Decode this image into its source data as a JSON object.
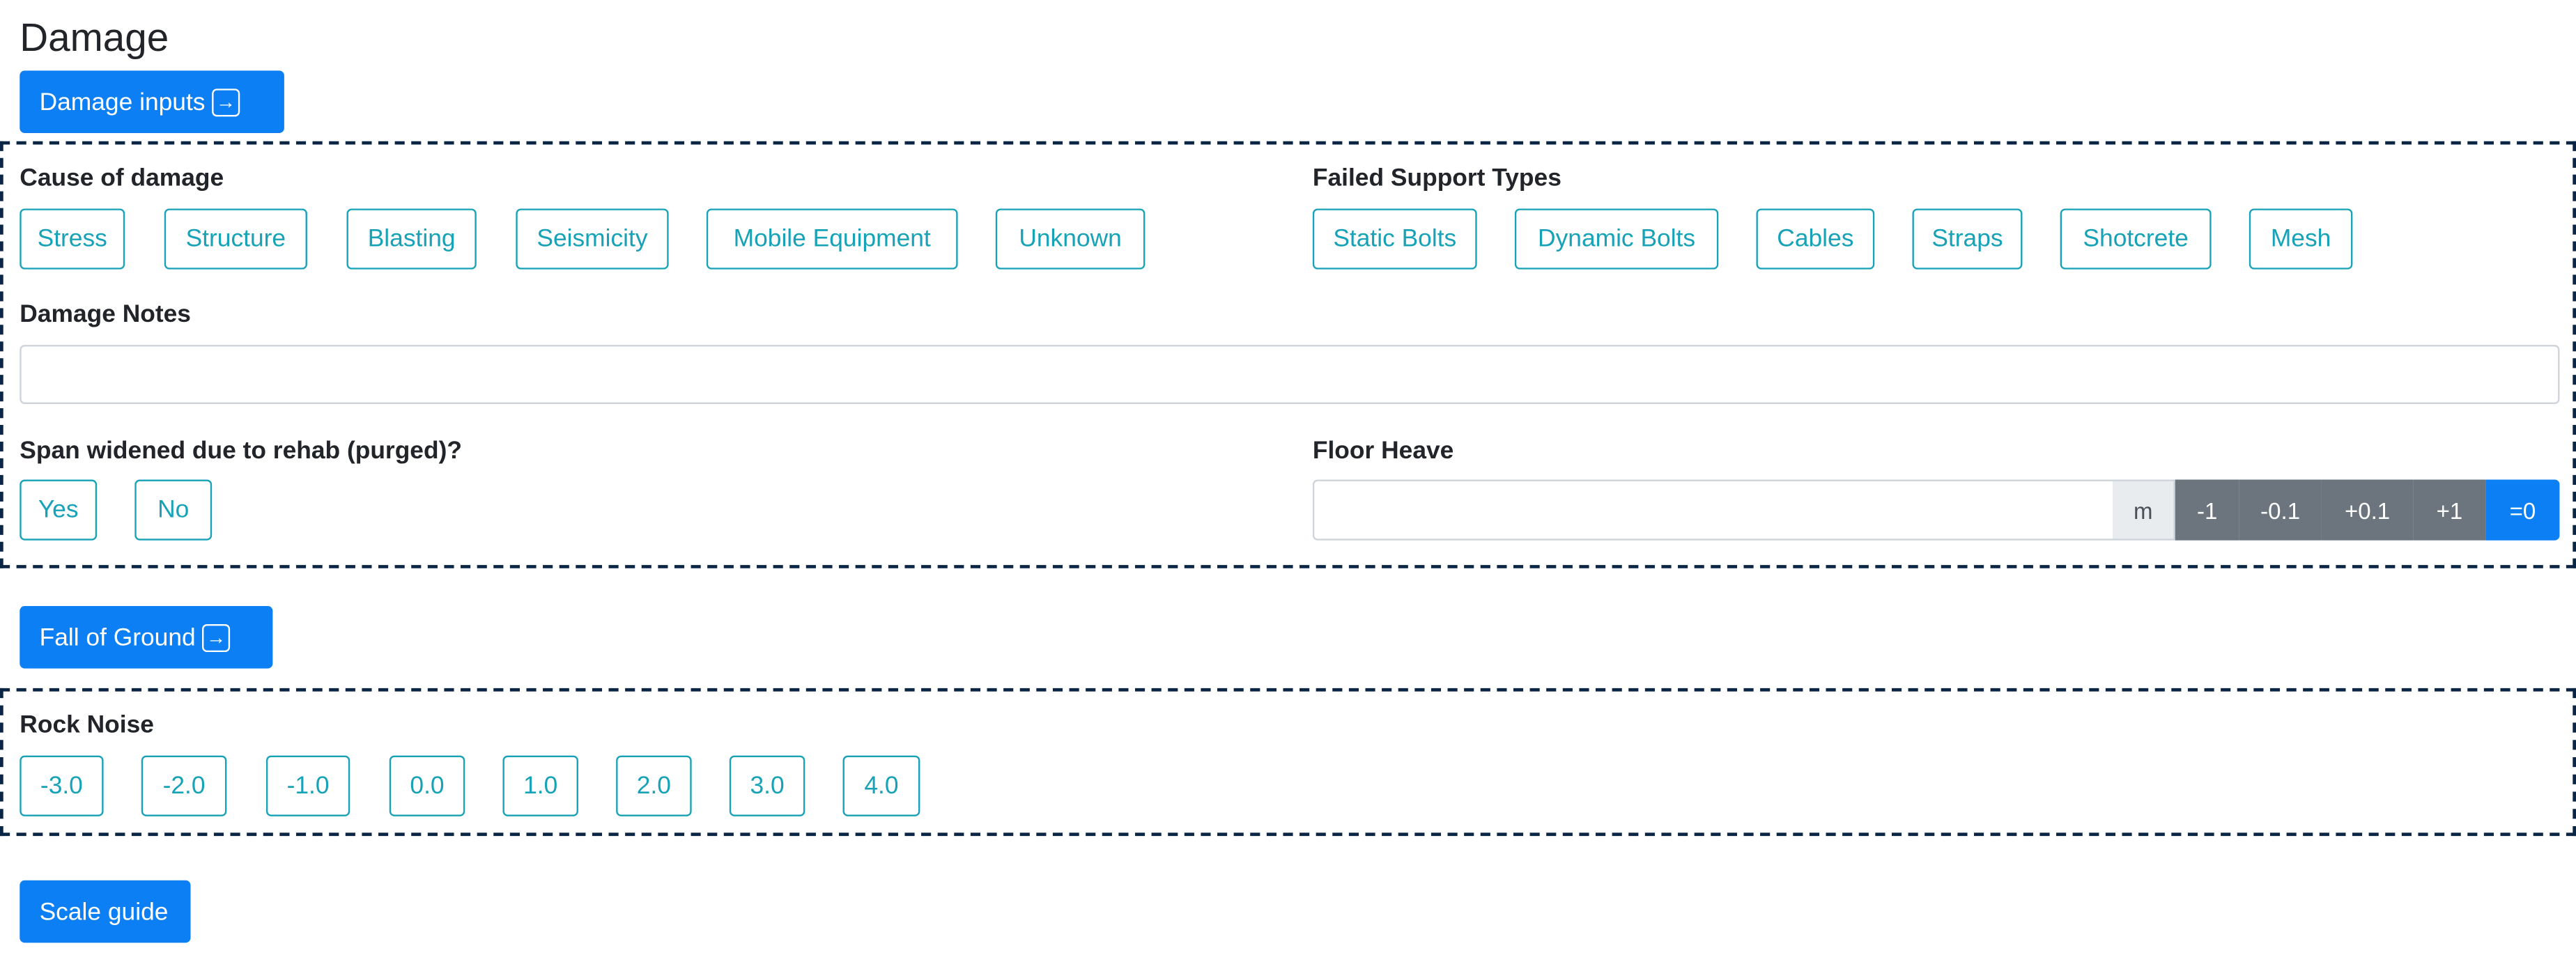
{
  "page": {
    "title": "Damage"
  },
  "damage_inputs": {
    "button_label": "Damage inputs"
  },
  "cause": {
    "label": "Cause of damage",
    "options": [
      "Stress",
      "Structure",
      "Blasting",
      "Seismicity",
      "Mobile Equipment",
      "Unknown"
    ]
  },
  "support": {
    "label": "Failed Support Types",
    "options": [
      "Static Bolts",
      "Dynamic Bolts",
      "Cables",
      "Straps",
      "Shotcrete",
      "Mesh"
    ]
  },
  "notes": {
    "label": "Damage Notes",
    "value": ""
  },
  "span": {
    "label": "Span widened due to rehab (purged)?",
    "options": [
      "Yes",
      "No"
    ]
  },
  "floor_heave": {
    "label": "Floor Heave",
    "value": "",
    "unit": "m",
    "adjust": [
      "-1",
      "-0.1",
      "+0.1",
      "+1"
    ],
    "reset": "=0"
  },
  "fall_of_ground": {
    "button_label": "Fall of Ground"
  },
  "rock_noise": {
    "label": "Rock Noise",
    "options": [
      "-3.0",
      "-2.0",
      "-1.0",
      "0.0",
      "1.0",
      "2.0",
      "3.0",
      "4.0"
    ]
  },
  "scale_guide": {
    "button_label": "Scale guide"
  },
  "colors": {
    "primary": "#0d7ff5",
    "outline": "#17a2b8",
    "secondary": "#6c757d",
    "panel_border": "#0b2545"
  },
  "icons": {
    "open": "arrow-right-box-icon"
  }
}
